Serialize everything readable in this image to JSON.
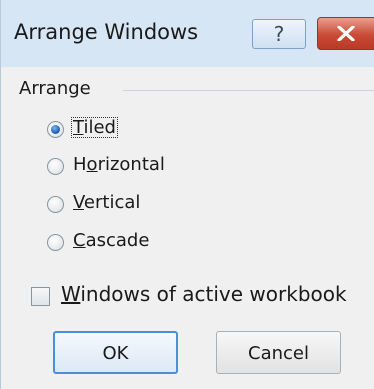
{
  "window": {
    "title": "Arrange Windows",
    "help_glyph": "?",
    "close_icon": "close-x-icon",
    "close_color": "#c94a36"
  },
  "arrange": {
    "group_label": "Arrange",
    "options": [
      {
        "label_mnemonic": "T",
        "label_rest": "iled",
        "checked": true
      },
      {
        "label_pre": "H",
        "label_mnemonic": "o",
        "label_rest": "rizontal",
        "checked": false
      },
      {
        "label_mnemonic": "V",
        "label_rest": "ertical",
        "checked": false
      },
      {
        "label_mnemonic": "C",
        "label_rest": "ascade",
        "checked": false
      }
    ]
  },
  "active_workbook": {
    "label_mnemonic": "W",
    "label_rest": "indows of active workbook",
    "checked": false
  },
  "buttons": {
    "ok": "OK",
    "cancel": "Cancel"
  }
}
